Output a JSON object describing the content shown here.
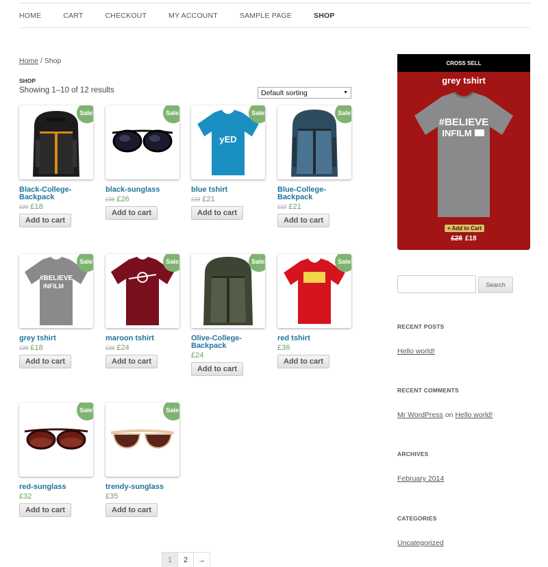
{
  "nav": {
    "items": [
      {
        "label": "HOME"
      },
      {
        "label": "CART"
      },
      {
        "label": "CHECKOUT"
      },
      {
        "label": "MY ACCOUNT"
      },
      {
        "label": "SAMPLE PAGE"
      },
      {
        "label": "SHOP"
      }
    ]
  },
  "breadcrumb": {
    "home": "Home",
    "separator": "/",
    "current": "Shop"
  },
  "page": {
    "heading": "SHOP",
    "result_count": "Showing 1–10 of 12 results"
  },
  "sorting": {
    "selected": "Default sorting"
  },
  "sale_label": "Sale!",
  "add_to_cart_label": "Add to cart",
  "products": [
    {
      "name": "Black-College-Backpack",
      "old_price": "£20",
      "price": "£18"
    },
    {
      "name": "black-sunglass",
      "old_price": "£28",
      "price": "£26"
    },
    {
      "name": "blue tshirt",
      "old_price": "£23",
      "price": "£21"
    },
    {
      "name": "Blue-College-Backpack",
      "old_price": "£22",
      "price": "£21"
    },
    {
      "name": "grey tshirt",
      "old_price": "£28",
      "price": "£18"
    },
    {
      "name": "maroon tshirt",
      "old_price": "£28",
      "price": "£24"
    },
    {
      "name": "Olive-College-Backpack",
      "old_price": "",
      "price": "£24"
    },
    {
      "name": "red tshirt",
      "old_price": "",
      "price": "£36"
    },
    {
      "name": "red-sunglass",
      "old_price": "",
      "price": "£32"
    },
    {
      "name": "trendy-sunglass",
      "old_price": "",
      "price": "£35"
    }
  ],
  "pagination": {
    "pages": [
      "1",
      "2"
    ],
    "next": "→",
    "current": "1"
  },
  "cross_sell": {
    "header": "CROSS SELL",
    "title": "grey tshirt",
    "shirt_text": "#BELIEVE INFILM",
    "button": "+ Add to Cart",
    "old_price": "£28",
    "price": "£18"
  },
  "search": {
    "button": "Search",
    "value": ""
  },
  "widgets": {
    "recent_posts": {
      "title": "RECENT POSTS",
      "items": [
        "Hello world!"
      ]
    },
    "recent_comments": {
      "title": "RECENT COMMENTS",
      "author": "Mr WordPress",
      "on": "on",
      "post": "Hello world!"
    },
    "archives": {
      "title": "ARCHIVES",
      "items": [
        "February 2014"
      ]
    },
    "categories": {
      "title": "CATEGORIES",
      "items": [
        "Uncategorized"
      ]
    }
  },
  "colors": {
    "link": "#21759b",
    "price": "#6c9e5f",
    "sale_badge": "#7fb371",
    "cross_sell_bg": "#a31515"
  }
}
